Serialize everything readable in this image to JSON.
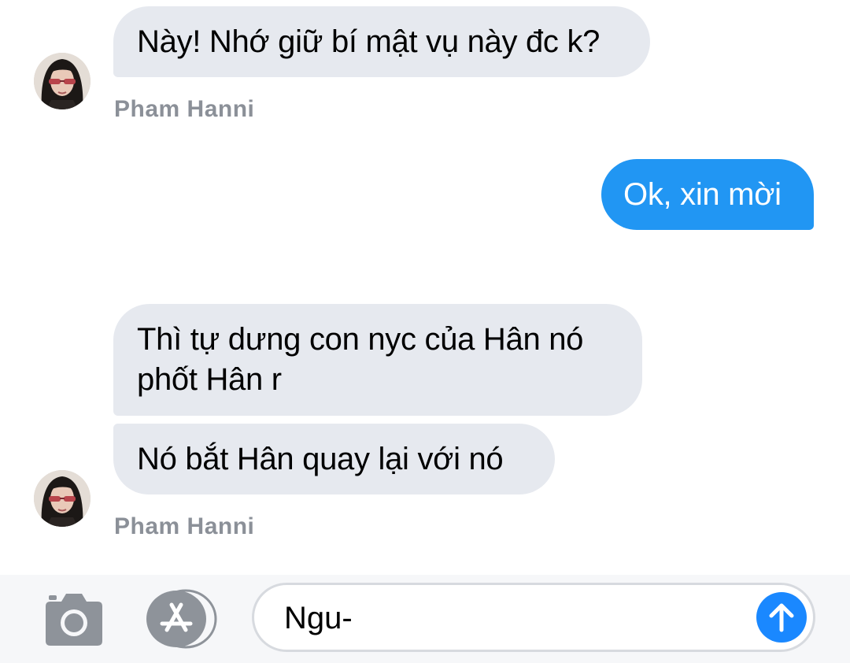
{
  "colors": {
    "incoming_bubble": "#e6e9ef",
    "outgoing_bubble": "#2196f3",
    "sender_name": "#8b9098",
    "accent": "#1a88ff"
  },
  "messages": [
    {
      "direction": "incoming",
      "text": "Này! Nhớ giữ bí mật vụ này đc k?"
    },
    {
      "direction": "outgoing",
      "text": "Ok, xin mời"
    },
    {
      "direction": "incoming",
      "text": "Thì tự dưng con nyc của Hân nó phốt Hân r"
    },
    {
      "direction": "incoming",
      "text": "Nó bắt Hân quay lại với nó"
    }
  ],
  "senders": [
    "Pham Hanni",
    "Pham Hanni"
  ],
  "composer": {
    "input_value": "Ngu-",
    "camera_icon": "camera-icon",
    "apps_icon": "app-store-icon",
    "send_icon": "send-arrow-up-icon"
  }
}
